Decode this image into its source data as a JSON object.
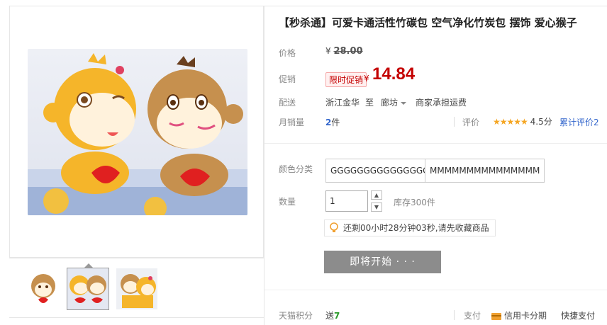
{
  "product": {
    "title": "【秒杀通】可爱卡通活性竹碳包 空气净化竹炭包 摆饰 爱心猴子"
  },
  "price": {
    "label": "价格",
    "currency": "¥",
    "original": "28.00"
  },
  "promo": {
    "label": "促销",
    "tag": "限时促销",
    "currency": "¥",
    "price": "14.84"
  },
  "shipping": {
    "label": "配送",
    "from": "浙江金华",
    "to_word": "至",
    "destination": "廊坊",
    "fee_note": "商家承担运费"
  },
  "sales": {
    "label": "月销量",
    "count": "2",
    "unit": "件",
    "rating_label": "评价",
    "stars": "★★★★★",
    "score": "4.5分",
    "total_reviews_label": "累计评价",
    "total_reviews": "2"
  },
  "sku": {
    "label": "颜色分类",
    "options": [
      "GGGGGGGGGGGGGGG",
      "MMMMMMMMMMMMMMM"
    ]
  },
  "quantity": {
    "label": "数量",
    "value": "1",
    "up": "▲",
    "down": "▼",
    "stock": "库存300件"
  },
  "notice": {
    "text": "还剩00小时28分钟03秒,请先收藏商品"
  },
  "buy": {
    "label": "即将开始 · · ·"
  },
  "footer": {
    "points_label": "天猫积分",
    "points_prefix": "送",
    "points_value": "7",
    "pay_label": "支付",
    "credit": "信用卡分期",
    "quick": "快捷支付"
  },
  "colors": {
    "accent": "#c40000",
    "link": "#3366cc",
    "star": "#f5a623",
    "buy_button": "#8c8c8c"
  }
}
